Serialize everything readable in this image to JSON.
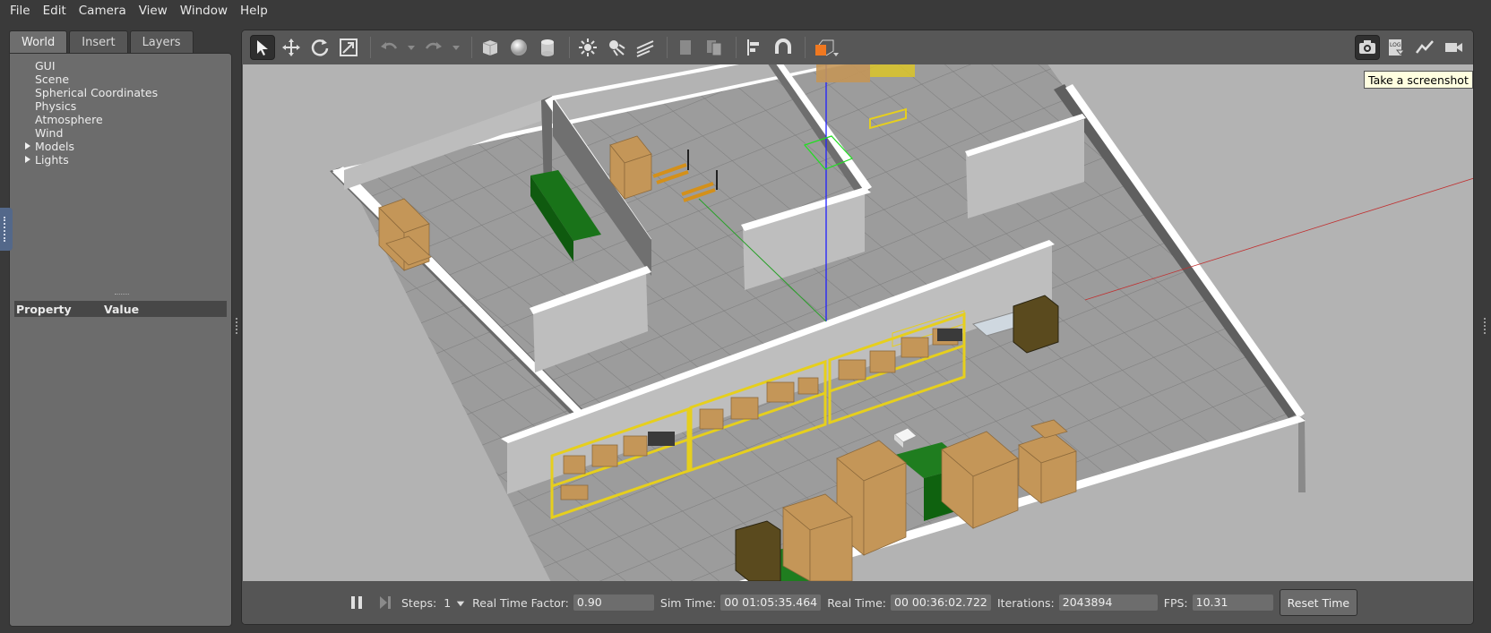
{
  "menu": [
    "File",
    "Edit",
    "Camera",
    "View",
    "Window",
    "Help"
  ],
  "left_tabs": [
    "World",
    "Insert",
    "Layers"
  ],
  "tree": [
    {
      "label": "GUI",
      "expandable": false
    },
    {
      "label": "Scene",
      "expandable": false
    },
    {
      "label": "Spherical Coordinates",
      "expandable": false
    },
    {
      "label": "Physics",
      "expandable": false
    },
    {
      "label": "Atmosphere",
      "expandable": false
    },
    {
      "label": "Wind",
      "expandable": false
    },
    {
      "label": "Models",
      "expandable": true
    },
    {
      "label": "Lights",
      "expandable": true
    }
  ],
  "property_header": {
    "property": "Property",
    "value": "Value"
  },
  "toolbar": {
    "left_icons": [
      "select-arrow-icon",
      "translate-icon",
      "rotate-icon",
      "scale-icon",
      "undo-icon",
      "undo-dropdown-icon",
      "redo-icon",
      "redo-dropdown-icon",
      "box-shape-icon",
      "sphere-shape-icon",
      "cylinder-shape-icon",
      "point-light-icon",
      "spot-light-icon",
      "directional-light-icon",
      "copy-icon",
      "paste-icon",
      "align-icon",
      "snap-icon",
      "view-angle-icon"
    ],
    "right_icons": [
      "screenshot-icon",
      "log-icon",
      "plot-icon",
      "video-record-icon"
    ]
  },
  "tooltip": "Take a screenshot",
  "status": {
    "steps_label": "Steps:",
    "steps_value": "1",
    "rtf_label": "Real Time Factor:",
    "rtf_value": "0.90",
    "sim_time_label": "Sim Time:",
    "sim_time_value": "00 01:05:35.464",
    "real_time_label": "Real Time:",
    "real_time_value": "00 00:36:02.722",
    "iterations_label": "Iterations:",
    "iterations_value": "2043894",
    "fps_label": "FPS:",
    "fps_value": "10.31",
    "reset_label": "Reset Time"
  },
  "colors": {
    "floor": "#9a9a9a",
    "wall_top": "#ffffff",
    "wall_side": "#6b6b6b",
    "shelf": "#e0c820",
    "box": "#c49a5a",
    "bin": "#1f7a1f"
  }
}
